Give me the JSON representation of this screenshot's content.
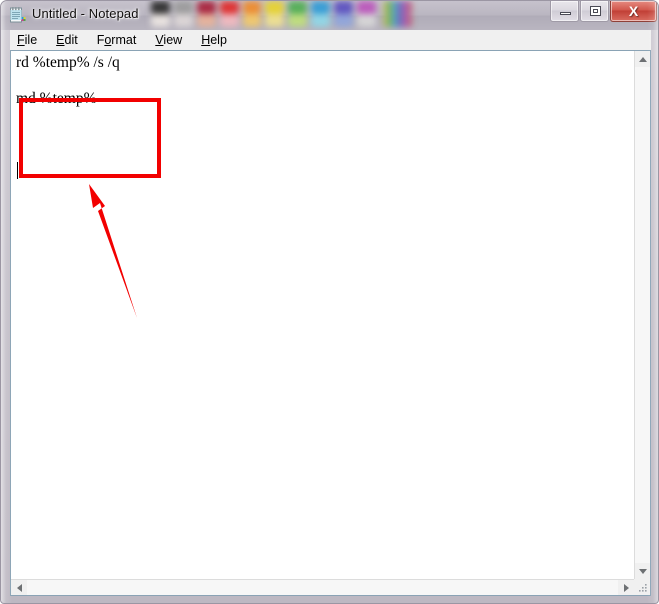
{
  "window": {
    "title": "Untitled - Notepad",
    "icon": "notepad-icon",
    "controls": {
      "minimize_label": "–",
      "maximize_label": "□",
      "close_label": "X"
    }
  },
  "menubar": {
    "items": [
      {
        "label": "File",
        "accel": "F",
        "rest": "ile"
      },
      {
        "label": "Edit",
        "accel": "E",
        "rest": "dit"
      },
      {
        "label": "Format",
        "accel": "F",
        "pre": "Fo",
        "rest": "rmat"
      },
      {
        "label": "View",
        "accel": "V",
        "rest": "iew"
      },
      {
        "label": "Help",
        "accel": "H",
        "rest": "elp"
      }
    ]
  },
  "document": {
    "lines": [
      "rd %temp% /s /q",
      "",
      "md %temp%",
      ""
    ],
    "caret_line": 4
  },
  "scrollbars": {
    "vertical": {
      "up_icon": "scroll-up-arrow-icon",
      "down_icon": "scroll-down-arrow-icon"
    },
    "horizontal": {
      "left_icon": "scroll-left-arrow-icon",
      "right_icon": "scroll-right-arrow-icon"
    },
    "grip_icon": "resize-grip-icon"
  },
  "annotations": {
    "highlight_color": "#f20000",
    "rect_label": "command-highlight-box",
    "arrow_label": "callout-arrow"
  },
  "palette_overlay": {
    "colors": [
      "#2b2b2b",
      "#9a9a9a",
      "#a8203a",
      "#e02a2a",
      "#ef8a2a",
      "#e8d32c",
      "#4fae52",
      "#2f9bd6",
      "#5a4fc0",
      "#bb54bb"
    ],
    "colors_lower": [
      "#ece6e2",
      "#ded8d8",
      "#e8b29a",
      "#f2b9bf",
      "#f3c96a",
      "#f0e28f",
      "#bfe07a",
      "#8fd8e8",
      "#8fa5dc",
      "#d8d8d8"
    ]
  }
}
